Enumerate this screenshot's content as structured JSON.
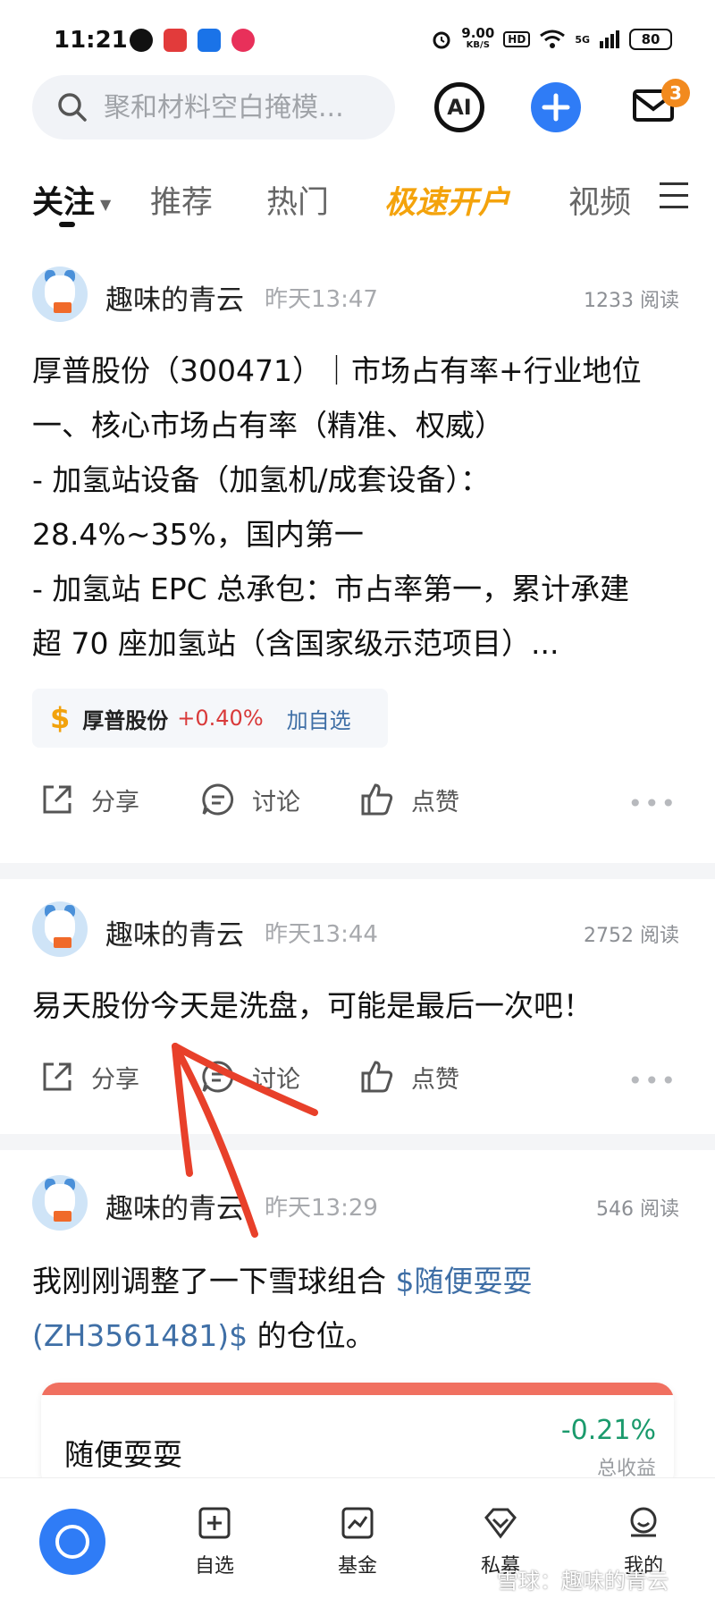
{
  "status_bar": {
    "time": "11:21",
    "net_speed_value": "9.00",
    "net_speed_unit": "KB/S",
    "hd": "HD",
    "signal": "5G",
    "battery": "80"
  },
  "header": {
    "search_placeholder": "聚和材料空白掩模...",
    "ai_label": "AI",
    "mail_badge": "3"
  },
  "tabs": [
    {
      "label": "关注",
      "active": true
    },
    {
      "label": "推荐"
    },
    {
      "label": "热门"
    },
    {
      "label": "极速开户",
      "promo": true
    },
    {
      "label": "视频"
    }
  ],
  "posts": [
    {
      "author": "趣味的青云",
      "time": "昨天13:47",
      "reads": "1233 阅读",
      "lines": [
        "厚普股份（300471）｜市场占有率+行业地位",
        "一、核心市场占有率（精准、权威）",
        "- 加氢站设备（加氢机/成套设备）：",
        "28.4%~35%，国内第一",
        "- 加氢站 EPC 总承包：市占率第一，累计承建",
        "超 70 座加氢站（含国家级示范项目）..."
      ],
      "stock": {
        "symbol": "$",
        "name": "厚普股份",
        "change": "+0.40%",
        "add": "加自选"
      }
    },
    {
      "author": "趣味的青云",
      "time": "昨天13:44",
      "reads": "2752 阅读",
      "text": "易天股份今天是洗盘，可能是最后一次吧！"
    },
    {
      "author": "趣味的青云",
      "time": "昨天13:29",
      "reads": "546 阅读",
      "text_before": "我刚刚调整了一下雪球组合 ",
      "link_1": "$随便耍耍",
      "link_2": "(ZH3561481)$",
      "text_after": " 的仓位。",
      "portfolio": {
        "name": "随便耍耍",
        "value": "-0.21%",
        "label": "总收益"
      }
    }
  ],
  "actions": {
    "share": "分享",
    "discuss": "讨论",
    "like": "点赞"
  },
  "bottom_nav": [
    {
      "label": "自选"
    },
    {
      "label": "基金"
    },
    {
      "label": "私募"
    },
    {
      "label": "我的"
    }
  ],
  "watermark": "雪球：趣味的青云",
  "colors": {
    "accent": "#2f7cf6",
    "promo": "#f4a30c",
    "up": "#d93a3a",
    "down": "#1a9a6c",
    "link": "#3f6fa6",
    "arrow": "#e8402a"
  }
}
